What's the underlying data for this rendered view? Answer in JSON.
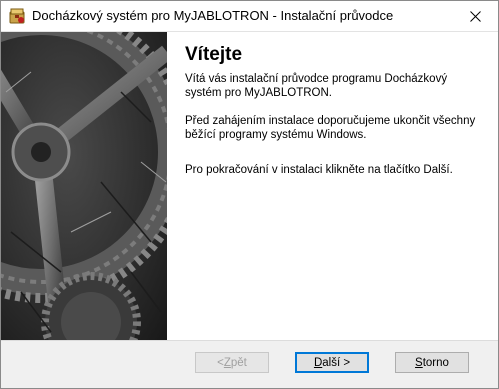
{
  "window": {
    "title": "Docházkový systém pro MyJABLOTRON - Instalační průvodce"
  },
  "main": {
    "heading": "Vítejte",
    "paragraphs": [
      "Vítá vás instalační průvodce programu Docházkový systém pro MyJABLOTRON.",
      "Před zahájením instalace doporučujeme ukončit všechny běžící programy systému Windows.",
      "Pro pokračování v instalaci klikněte na tlačítko Další."
    ]
  },
  "buttons": {
    "back": {
      "pre": "< ",
      "ul": "Z",
      "post": "pět",
      "enabled": false
    },
    "next": {
      "pre": "",
      "ul": "D",
      "post": "alší >",
      "enabled": true
    },
    "cancel": {
      "pre": "",
      "ul": "S",
      "post": "torno",
      "enabled": true
    }
  },
  "colors": {
    "focus_border": "#0078d7",
    "footer_bg": "#f0f0f0",
    "button_bg": "#e1e1e1"
  },
  "icons": {
    "app": "installer-icon",
    "close": "close-icon",
    "side": "gear-artwork"
  }
}
